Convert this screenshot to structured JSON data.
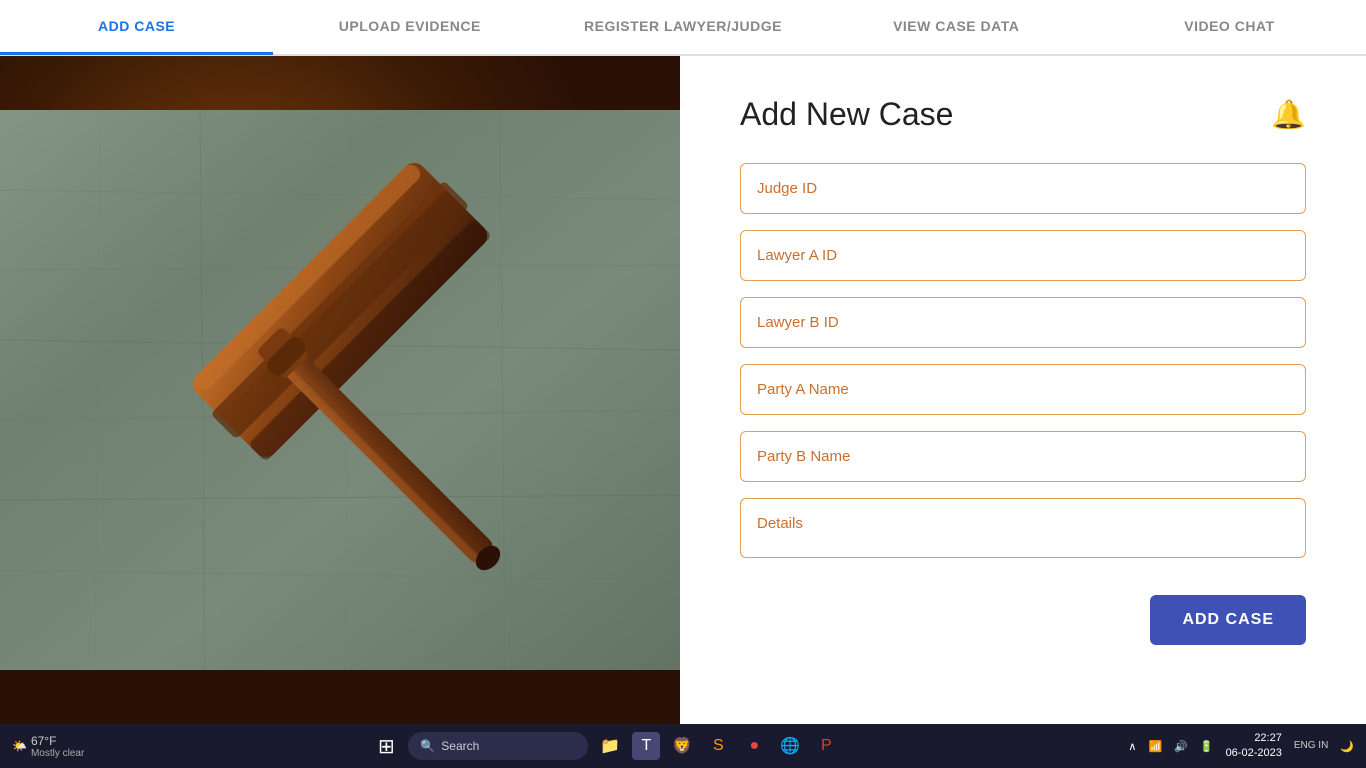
{
  "browser": {
    "url": "localhost:3000",
    "tab_title": "New"
  },
  "nav": {
    "items": [
      {
        "id": "add-case",
        "label": "ADD CASE",
        "active": true
      },
      {
        "id": "upload-evidence",
        "label": "UPLOAD EVIDENCE",
        "active": false
      },
      {
        "id": "register-lawyer-judge",
        "label": "REGISTER LAWYER/JUDGE",
        "active": false
      },
      {
        "id": "view-case-data",
        "label": "VIEW CASE DATA",
        "active": false
      },
      {
        "id": "video-chat",
        "label": "VIDEO CHAT",
        "active": false
      }
    ]
  },
  "form": {
    "title": "Add New Case",
    "bell_icon": "🔔",
    "fields": {
      "judge_id_placeholder": "Judge ID",
      "lawyer_a_id_placeholder": "Lawyer A ID",
      "lawyer_b_id_placeholder": "Lawyer B ID",
      "party_a_name_placeholder": "Party A Name",
      "party_b_name_placeholder": "Party B Name",
      "details_placeholder": "Details"
    },
    "submit_button": "ADD CASE"
  },
  "taskbar": {
    "weather": "67°F",
    "weather_desc": "Mostly clear",
    "search_placeholder": "Search",
    "time": "22:27",
    "date": "06-02-2023",
    "lang": "ENG IN"
  }
}
